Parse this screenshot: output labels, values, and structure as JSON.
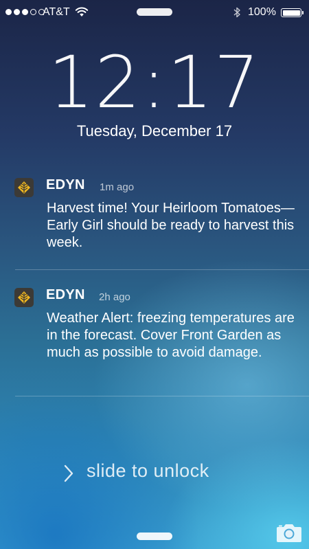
{
  "status_bar": {
    "carrier": "AT&T",
    "signal_bars_filled": 3,
    "signal_bars_total": 5,
    "battery_percent": "100%",
    "icons": [
      "wifi-icon",
      "bluetooth-icon",
      "battery-icon"
    ]
  },
  "lock_screen": {
    "time": "12:17",
    "date": "Tuesday, December 17"
  },
  "notifications": [
    {
      "app": "EDYN",
      "time_ago": "1m ago",
      "message": "Harvest time! Your Heirloom Tomatoes—Early Girl should be ready to harvest this week.",
      "icon": "edyn-leaf-icon"
    },
    {
      "app": "EDYN",
      "time_ago": "2h ago",
      "message": "Weather Alert: freezing temperatures are in the forecast. Cover Front Garden as much as possible to avoid damage.",
      "icon": "edyn-leaf-icon"
    }
  ],
  "unlock": {
    "label": "slide to unlock"
  },
  "colors": {
    "app_icon_bg": "#3c3a36",
    "app_icon_leaf": "#f2b81f",
    "text": "#ffffff"
  }
}
